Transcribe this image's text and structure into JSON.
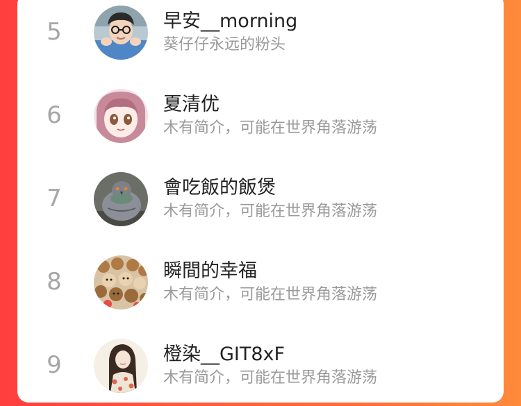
{
  "ranking": {
    "items": [
      {
        "rank": "5",
        "name": "早安__morning",
        "bio": "葵仔仔永远的粉头",
        "avatar_icon": "avatar-boy-photo-icon"
      },
      {
        "rank": "6",
        "name": "夏清优",
        "bio": "木有简介，可能在世界角落游荡",
        "avatar_icon": "avatar-anime-girl-icon"
      },
      {
        "rank": "7",
        "name": "會吃飯的飯煲",
        "bio": "木有简介，可能在世界角落游荡",
        "avatar_icon": "avatar-pigeon-icon"
      },
      {
        "rank": "8",
        "name": "瞬間的幸福",
        "bio": "木有简介，可能在世界角落游荡",
        "avatar_icon": "avatar-teddy-bears-icon"
      },
      {
        "rank": "9",
        "name": "橙染__GIT8xF",
        "bio": "木有简介，可能在世界角落游荡",
        "avatar_icon": "avatar-illustrated-girl-icon"
      }
    ]
  },
  "colors": {
    "background_left": "#ff3e3e",
    "background_right": "#ff8a3a",
    "panel": "#ffffff",
    "rank_number": "#a6a6a6",
    "name_text": "#222222",
    "bio_text": "#9a9a9a"
  }
}
